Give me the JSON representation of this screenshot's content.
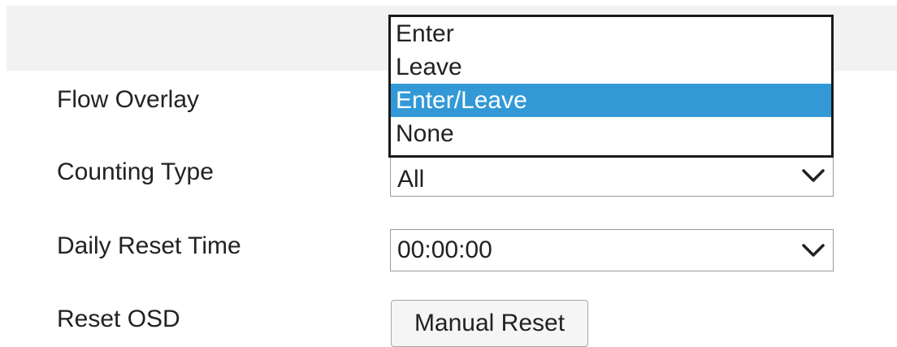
{
  "form": {
    "flow_overlay": {
      "label": "Flow Overlay",
      "options": [
        "Enter",
        "Leave",
        "Enter/Leave",
        "None"
      ],
      "selected_option": "Enter/Leave",
      "dropdown_open": true
    },
    "counting_type": {
      "label": "Counting Type",
      "value": "All"
    },
    "daily_reset_time": {
      "label": "Daily Reset Time",
      "value": "00:00:00"
    },
    "reset_osd": {
      "label": "Reset OSD",
      "button_label": "Manual Reset"
    }
  },
  "icons": {
    "select_arrow": "chevron-down-icon"
  },
  "colors": {
    "selected_option_bg": "#3399d6",
    "selected_option_text": "#ffffff",
    "header_band": "#f2f2f2",
    "dropdown_border": "#1a1a1a"
  }
}
